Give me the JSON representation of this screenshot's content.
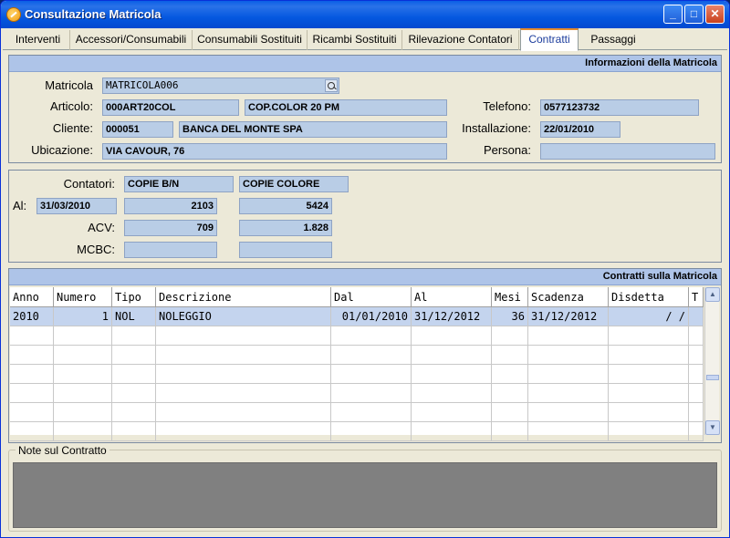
{
  "window": {
    "title": "Consultazione Matricola"
  },
  "tabs": [
    {
      "label": "Interventi"
    },
    {
      "label": "Accessori/Consumabili"
    },
    {
      "label": "Consumabili Sostituiti"
    },
    {
      "label": "Ricambi Sostituiti"
    },
    {
      "label": "Rilevazione Contatori"
    },
    {
      "label": "Contratti"
    },
    {
      "label": "Passaggi"
    }
  ],
  "active_tab": "Contratti",
  "info": {
    "header": "Informazioni della Matricola",
    "matricola_label": "Matricola",
    "matricola": "MATRICOLA006",
    "articolo_label": "Articolo:",
    "articolo_code": "000ART20COL",
    "articolo_desc": "COP.COLOR 20 PM",
    "telefono_label": "Telefono:",
    "telefono": "0577123732",
    "cliente_label": "Cliente:",
    "cliente_code": "000051",
    "cliente_name": "BANCA DEL MONTE SPA",
    "installazione_label": "Installazione:",
    "installazione": "22/01/2010",
    "ubicazione_label": "Ubicazione:",
    "ubicazione": "VIA CAVOUR, 76",
    "persona_label": "Persona:",
    "persona": ""
  },
  "counters": {
    "contatori_label": "Contatori:",
    "col1": "COPIE B/N",
    "col2": "COPIE COLORE",
    "al_label": "Al:",
    "al_date": "31/03/2010",
    "al_bn": "2103",
    "al_col": "5424",
    "acv_label": "ACV:",
    "acv_bn": "709",
    "acv_col": "1.828",
    "mcbc_label": "MCBC:",
    "mcbc_bn": "",
    "mcbc_col": ""
  },
  "contracts": {
    "header": "Contratti sulla Matricola",
    "columns": [
      "Anno",
      "Numero",
      "Tipo",
      "Descrizione",
      "Dal",
      "Al",
      "Mesi",
      "Scadenza",
      "Disdetta",
      "T"
    ],
    "rows": [
      [
        "2010",
        "1",
        "NOL",
        "NOLEGGIO",
        "01/01/2010",
        "31/12/2012",
        "36",
        "31/12/2012",
        "  /  /",
        ""
      ]
    ]
  },
  "notes": {
    "title": "Note sul Contratto",
    "text": ""
  },
  "colors": {
    "titlebar": "#0558e0",
    "field": "#b9cde6",
    "header": "#aec4e8",
    "selected_row": "#c4d4ee"
  }
}
